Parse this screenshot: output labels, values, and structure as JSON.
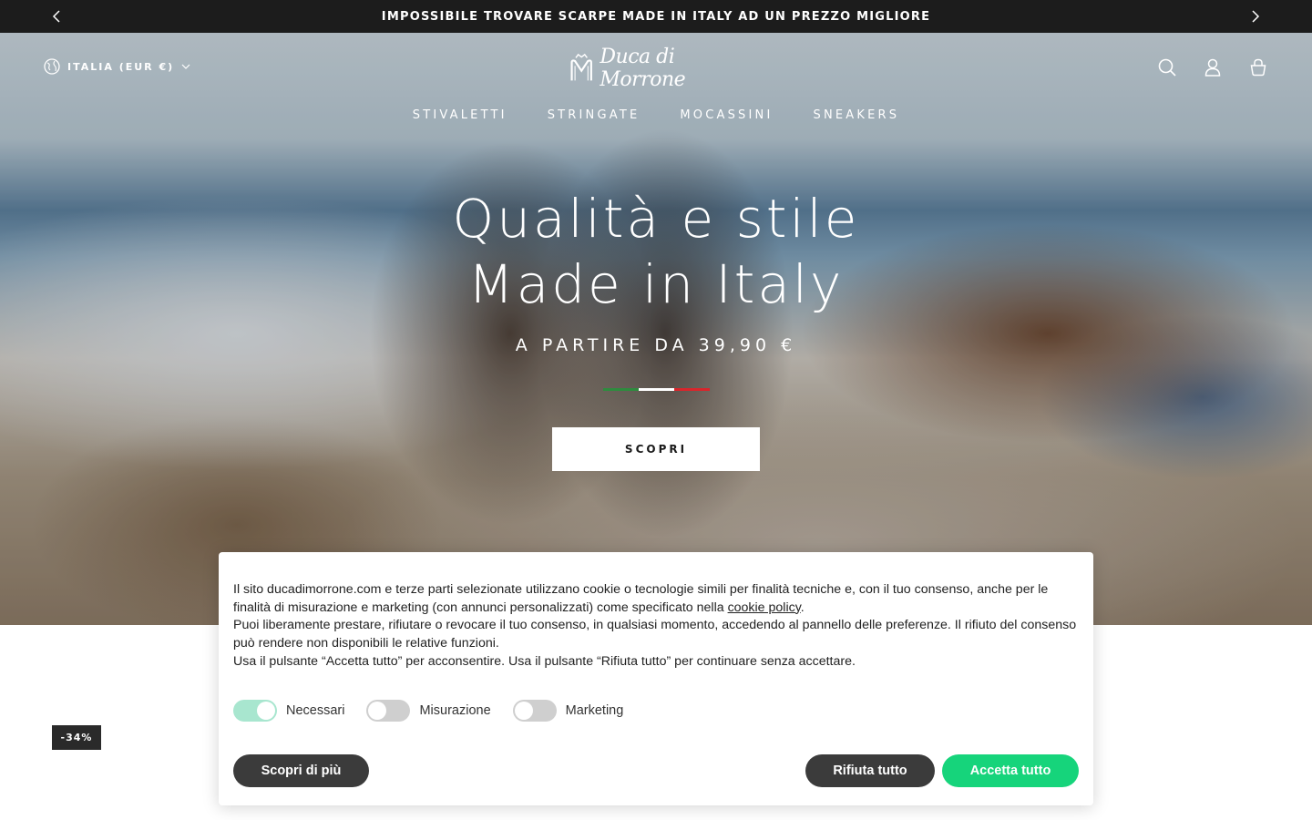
{
  "announcement": {
    "text": "IMPOSSIBILE TROVARE SCARPE MADE IN ITALY AD UN PREZZO MIGLIORE",
    "prev_icon": "chevron-left-icon",
    "next_icon": "chevron-right-icon"
  },
  "header": {
    "locale_label": "ITALIA (EUR €)",
    "locale_icon": "globe-icon",
    "logo_text": "Duca di Morrone",
    "icons": [
      "search-icon",
      "account-icon",
      "cart-icon"
    ]
  },
  "nav": {
    "items": [
      "STIVALETTI",
      "STRINGATE",
      "MOCASSINI",
      "SNEAKERS"
    ]
  },
  "hero": {
    "title_line1": "Qualità e stile",
    "title_line2": "Made in Italy",
    "subtitle": "A PARTIRE DA 39,90 €",
    "flag_colors": [
      "#2e8b3e",
      "#ffffff",
      "#d9252b"
    ],
    "cta_label": "SCOPRI"
  },
  "product": {
    "discount_badge": "-34%"
  },
  "cookie_banner": {
    "paragraph1_before_link": "Il sito ducadimorrone.com e terze parti selezionate utilizzano cookie o tecnologie simili per finalità tecniche e, con il tuo consenso, anche per le finalità di misurazione e marketing (con annunci personalizzati) come specificato nella ",
    "link_text": "cookie policy",
    "paragraph1_after_link": ".",
    "paragraph2": "Puoi liberamente prestare, rifiutare o revocare il tuo consenso, in qualsiasi momento, accedendo al pannello delle preferenze. Il rifiuto del consenso può rendere non disponibili le relative funzioni.",
    "paragraph3": "Usa il pulsante “Accetta tutto” per acconsentire. Usa il pulsante “Rifiuta tutto” per continuare senza accettare.",
    "toggles": [
      {
        "label": "Necessari",
        "on": true
      },
      {
        "label": "Misurazione",
        "on": false
      },
      {
        "label": "Marketing",
        "on": false
      }
    ],
    "buttons": {
      "more": "Scopri di più",
      "reject": "Rifiuta tutto",
      "accept": "Accetta tutto"
    },
    "colors": {
      "toggle_on": "#a8e6cf",
      "toggle_off": "#cfcfcf",
      "dark_button": "#3b3b3b",
      "accept_button": "#16d47b"
    }
  }
}
